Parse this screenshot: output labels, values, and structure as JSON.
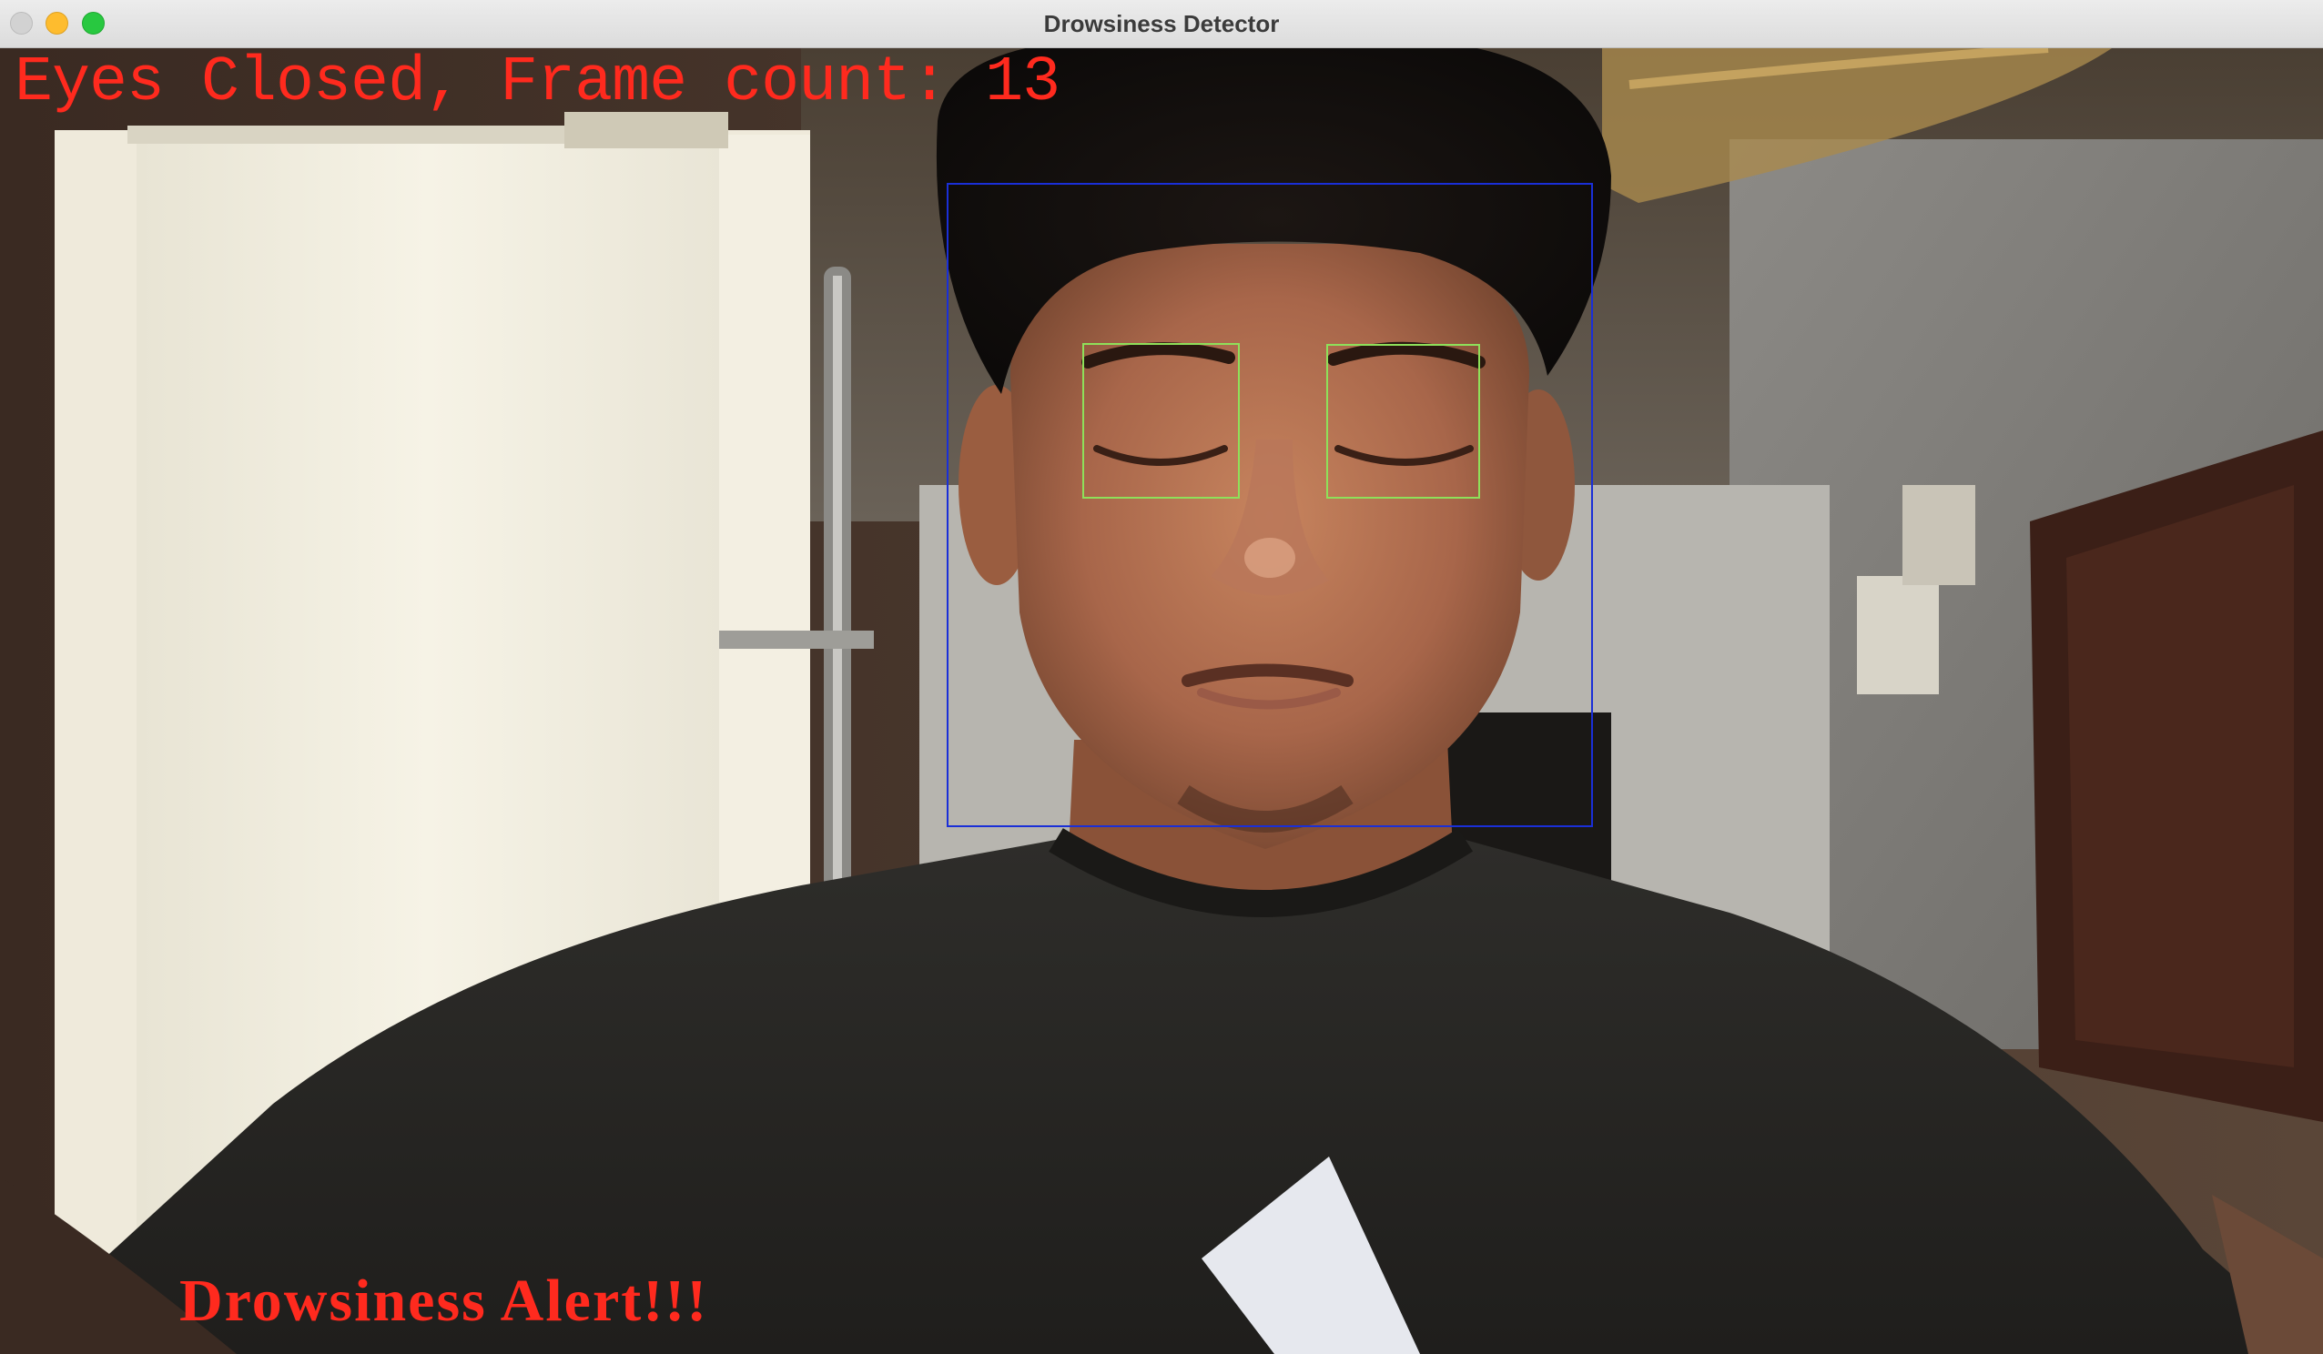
{
  "window": {
    "title": "Drowsiness Detector"
  },
  "overlay": {
    "status_text": "Eyes Closed, Frame count: 13",
    "alert_text": "Drowsiness Alert!!!"
  },
  "detections": {
    "face_box_color": "#1a2fd8",
    "eye_box_color": "#8ee05a"
  },
  "colors": {
    "overlay_text": "#ff2a1e"
  }
}
